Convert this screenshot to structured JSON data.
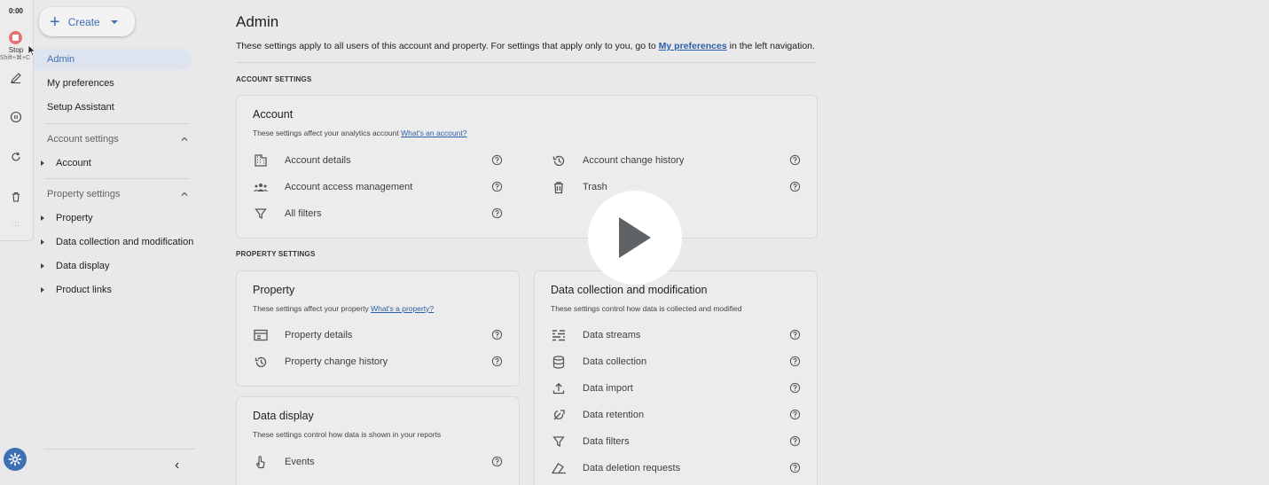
{
  "recorder": {
    "time": "0:00",
    "stop_label": "Stop",
    "shortcut": "Shift+⌘+C",
    "grip": ":::"
  },
  "sidebar": {
    "create_label": "Create",
    "nav": [
      "Admin",
      "My preferences",
      "Setup Assistant"
    ],
    "account_settings_label": "Account settings",
    "account_items": [
      "Account"
    ],
    "property_settings_label": "Property settings",
    "property_items": [
      "Property",
      "Data collection and modification",
      "Data display",
      "Product links"
    ],
    "collapse_glyph": "‹"
  },
  "main": {
    "title": "Admin",
    "desc_before": "These settings apply to all users of this account and property. For settings that apply only to you, go to ",
    "desc_link": "My preferences",
    "desc_after": " in the left navigation.",
    "account_section_label": "ACCOUNT SETTINGS",
    "property_section_label": "PROPERTY SETTINGS",
    "account_card": {
      "title": "Account",
      "subtitle": "These settings affect your analytics account ",
      "subtitle_link": "What's an account?",
      "left_rows": [
        {
          "label": "Account details",
          "icon": "building-icon"
        },
        {
          "label": "Account access management",
          "icon": "people-icon"
        },
        {
          "label": "All filters",
          "icon": "filter-icon"
        }
      ],
      "right_rows": [
        {
          "label": "Account change history",
          "icon": "history-icon"
        },
        {
          "label": "Trash",
          "icon": "trash-icon"
        }
      ]
    },
    "property_card": {
      "title": "Property",
      "subtitle": "These settings affect your property ",
      "subtitle_link": "What's a property?",
      "rows": [
        {
          "label": "Property details",
          "icon": "property-card-icon"
        },
        {
          "label": "Property change history",
          "icon": "history-icon"
        }
      ]
    },
    "display_card": {
      "title": "Data display",
      "subtitle": "These settings control how data is shown in your reports",
      "rows": [
        {
          "label": "Events",
          "icon": "touch-icon"
        }
      ]
    },
    "collection_card": {
      "title": "Data collection and modification",
      "subtitle": "These settings control how data is collected and modified",
      "rows": [
        {
          "label": "Data streams",
          "icon": "streams-icon"
        },
        {
          "label": "Data collection",
          "icon": "database-icon"
        },
        {
          "label": "Data import",
          "icon": "upload-icon"
        },
        {
          "label": "Data retention",
          "icon": "retention-icon"
        },
        {
          "label": "Data filters",
          "icon": "filter-icon"
        },
        {
          "label": "Data deletion requests",
          "icon": "eraser-icon"
        }
      ]
    }
  },
  "colors": {
    "accent": "#3f6fb3",
    "link": "#2b5fa8",
    "overlay_bg": "#e9e9e9",
    "stop_red": "#e57373"
  },
  "overlay": {
    "play_icon": "play-icon"
  }
}
